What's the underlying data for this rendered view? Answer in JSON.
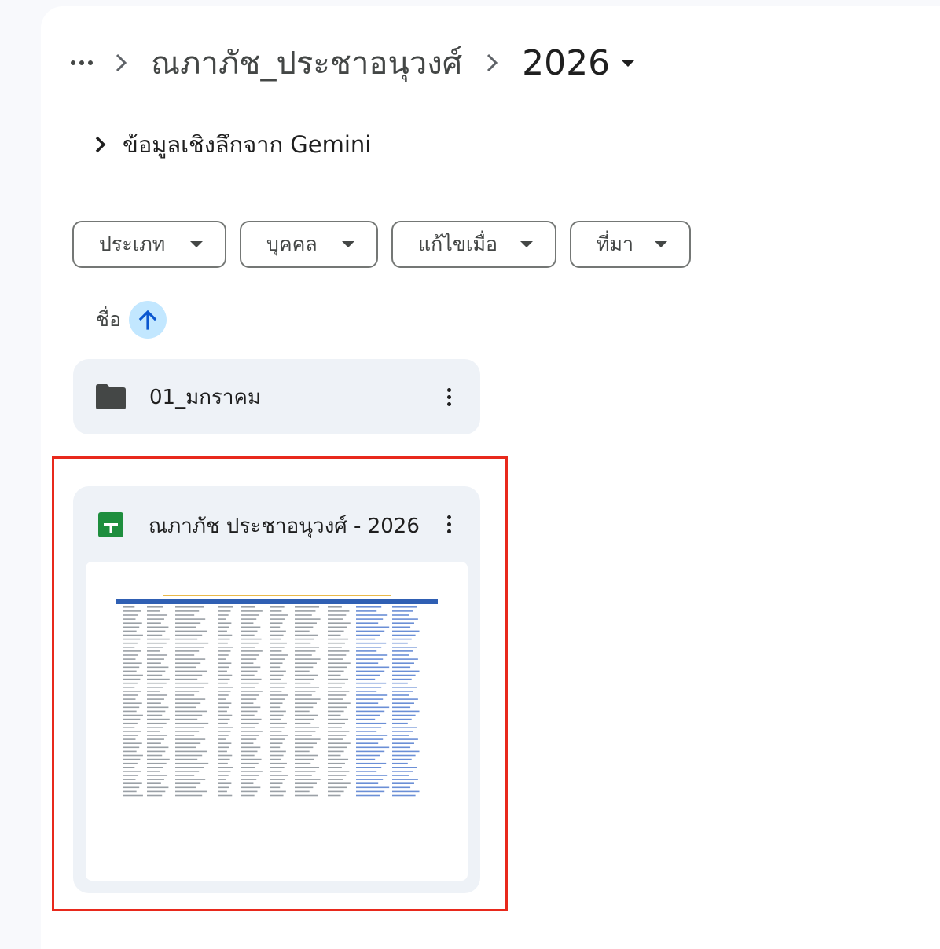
{
  "breadcrumb": {
    "more_icon": "more-horiz-icon",
    "parent": "ณภาภัช_ประชาอนุวงศ์",
    "current": "2026"
  },
  "gemini": {
    "label": "ข้อมูลเชิงลึกจาก Gemini"
  },
  "filters": [
    {
      "label": "ประเภท"
    },
    {
      "label": "บุคคล"
    },
    {
      "label": "แก้ไขเมื่อ"
    },
    {
      "label": "ที่มา"
    }
  ],
  "sort": {
    "label": "ชื่อ",
    "direction": "ascending",
    "icon": "arrow-upward-icon"
  },
  "items": [
    {
      "type": "folder",
      "name": "01_มกราคม",
      "icon": "folder-icon"
    },
    {
      "type": "spreadsheet",
      "name": "ณภาภัช ประชาอนุวงศ์ - 2026",
      "icon": "google-sheets-icon",
      "selected": true
    }
  ],
  "colors": {
    "accent": "#c2e7ff",
    "accent_icon": "#0b57d0",
    "sheets_green": "#1e8e3e",
    "highlight_border": "#e8291c",
    "card_bg": "#eef2f7"
  }
}
